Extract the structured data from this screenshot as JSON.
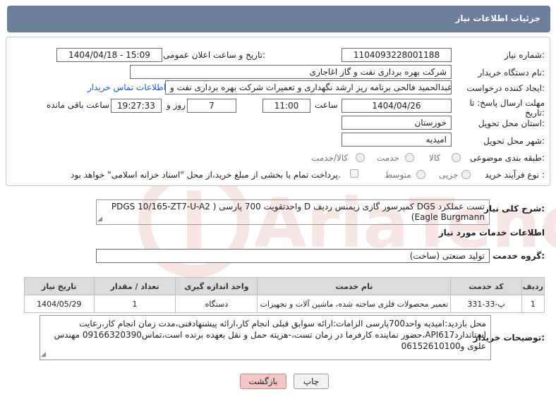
{
  "title": "جزئیات اطلاعات نیاز",
  "fields": {
    "need_number_label": "شماره نیاز:",
    "need_number": "1104093228001188",
    "announce_label": "تاریخ و ساعت اعلان عمومی:",
    "announce_value": "1404/04/18 - 15:09",
    "buyer_label": "نام دستگاه خریدار:",
    "buyer_value": "شرکت بهره برداری نفت و گاز اغاجاری",
    "creator_label": "ایجاد کننده درخواست:",
    "creator_value": "عبدالحمید فالحی برنامه ریز ارشد نگهداری و تعمیرات شرکت بهره برداری نفت و",
    "contact_link": "اطلاعات تماس خریدار",
    "deadline_label": "مهلت ارسال پاسخ: تا تاریخ:",
    "deadline_date": "1404/04/26",
    "time_label": "ساعت",
    "deadline_time": "11:00",
    "days_value": "7",
    "days_label": "روز و",
    "remain_time": "19:27:33",
    "remain_label": "ساعت باقی مانده",
    "province_label": "استان محل تحویل:",
    "province_value": "خوزستان",
    "city_label": "شهر محل تحویل:",
    "city_value": "امیدیه",
    "category_label": "طبقه بندی موضوعی:",
    "cat_goods": "کالا",
    "cat_service": "خدمت",
    "cat_goods_service": "کالا/خدمت",
    "process_label": "نوع فرآیند خرید :",
    "proc_partial": "جزیی",
    "proc_medium": "متوسط",
    "payment_note": "پرداخت تمام یا بخشی از مبلغ خرید،از محل \"اسناد خزانه اسلامی\" خواهد بود."
  },
  "summary": {
    "label": "شرح کلی نیاز:",
    "text": "تست عملکرد DGS کمپرسور گازی زیمنس ردیف D واحدتقویت 700 پارسی ( PDGS 10/165-ZT7-U-A2 Eagle Burgmann)"
  },
  "services": {
    "section_title": "اطلاعات خدمات مورد نیاز",
    "group_label": "گروه خدمت:",
    "group_value": "تولید صنعتی (ساخت)",
    "columns": [
      "ردیف",
      "کد خدمت",
      "نام خدمت",
      "واحد اندازه گیری",
      "تعداد / مقدار",
      "تاریخ نیاز"
    ],
    "rows": [
      [
        "1",
        "پ-33-331",
        "تعمیر محصولات فلزی ساخته شده، ماشین آلات و تجهیزات",
        "دستگاه",
        "1",
        "1404/05/29"
      ]
    ]
  },
  "buyer_notes": {
    "label": "توضیحات خریدار:",
    "text": "محل بازدید:امیدیه واحد700پارسی الزامات:ارائه سوابق قبلی انجام کار،ارائه پیشنهادفنی،مدت زمان انجام کار،رعایت استانداردAPI617،حضور نماینده کارفرما در زمان تست،-هزینه حمل و نقل بعهده برنده است،تماس09166320390 مهندس علوی و06152610100"
  },
  "buttons": {
    "print": "چاپ",
    "back": "بازگشت"
  },
  "colors": {
    "titlebar": "#6b7f9c",
    "link": "#1f58c4",
    "back_button_bg": "#f4c6c6"
  }
}
